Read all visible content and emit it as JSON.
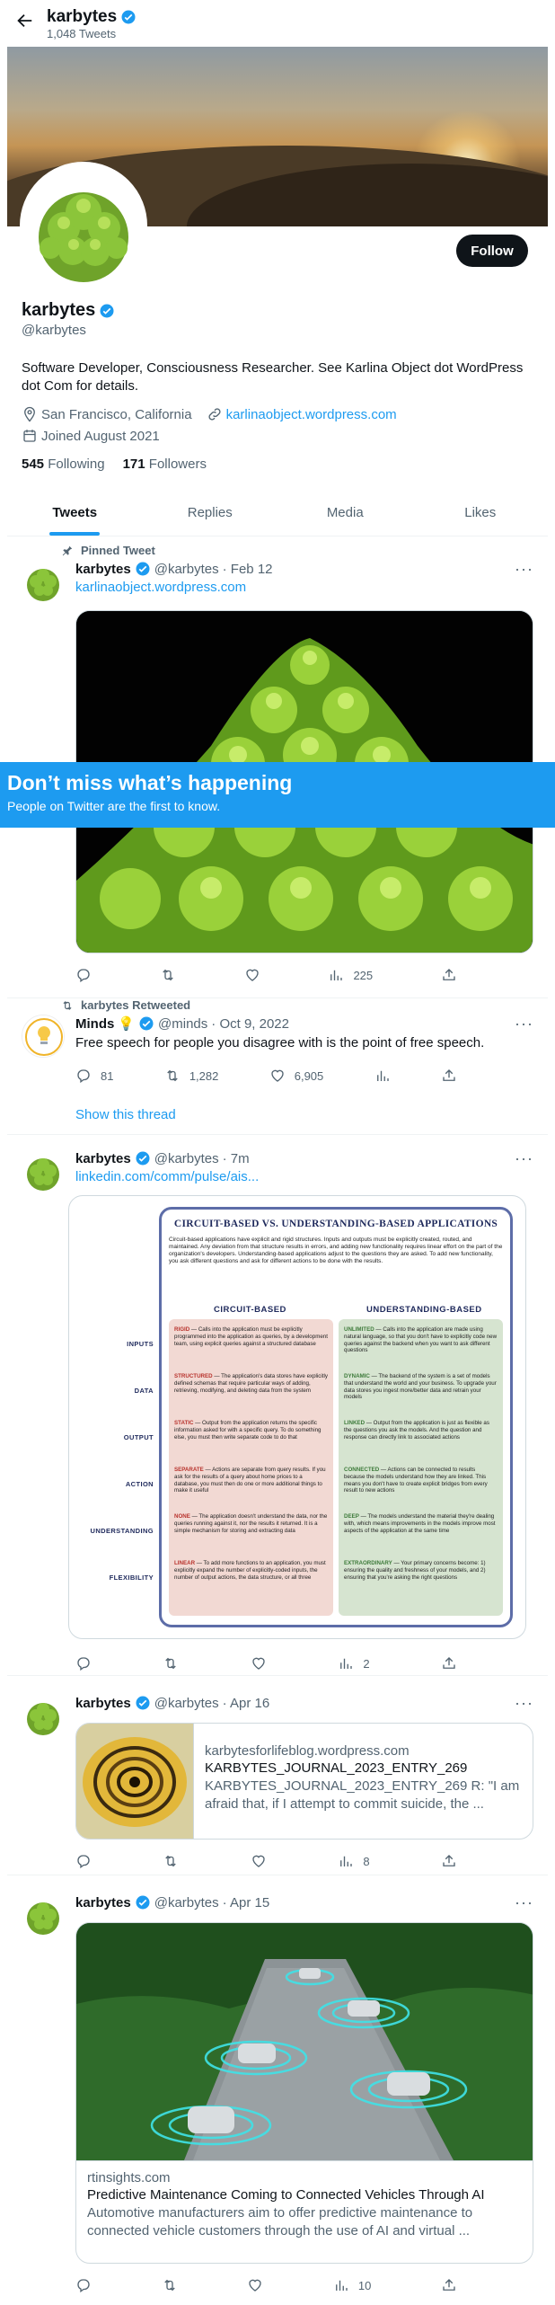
{
  "header": {
    "name": "karbytes",
    "tweet_count": "1,048 Tweets"
  },
  "profile": {
    "name": "karbytes",
    "handle": "@karbytes",
    "bio": "Software Developer, Consciousness Researcher. See Karlina Object dot WordPress dot Com for details.",
    "location": "San Francisco, California",
    "website": "karlinaobject.wordpress.com",
    "joined": "Joined August 2021",
    "following_count": "545",
    "following_label": "Following",
    "followers_count": "171",
    "followers_label": "Followers",
    "follow_button": "Follow"
  },
  "tabs": [
    {
      "label": "Tweets"
    },
    {
      "label": "Replies"
    },
    {
      "label": "Media"
    },
    {
      "label": "Likes"
    }
  ],
  "signup_banner": {
    "title": "Don’t miss what’s happening",
    "subtitle": "People on Twitter are the first to know."
  },
  "tweets": [
    {
      "social": "Pinned Tweet",
      "name": "karbytes",
      "handle": "@karbytes",
      "date": "· Feb 12",
      "link": "karlinaobject.wordpress.com",
      "views": "225"
    },
    {
      "social": "karbytes Retweeted",
      "name": "Minds",
      "handle": "@minds",
      "date": "· Oct 9, 2022",
      "text": "Free speech for people you disagree with is the point of free speech.",
      "replies": "81",
      "retweets": "1,282",
      "likes": "6,905",
      "show_thread": "Show this thread"
    },
    {
      "name": "karbytes",
      "handle": "@karbytes",
      "date": "· 7m",
      "link": "linkedin.com/comm/pulse/ais...",
      "views": "2"
    },
    {
      "name": "karbytes",
      "handle": "@karbytes",
      "date": "· Apr 16",
      "card_domain": "karbytesforlifeblog.wordpress.com",
      "card_title": "KARBYTES_JOURNAL_2023_ENTRY_269",
      "card_desc": "KARBYTES_JOURNAL_2023_ENTRY_269 R: \"I am afraid that, if I attempt to commit suicide, the ...",
      "views": "8"
    },
    {
      "name": "karbytes",
      "handle": "@karbytes",
      "date": "· Apr 15",
      "card_domain": "rtinsights.com",
      "card_title": "Predictive Maintenance Coming to Connected Vehicles Through AI",
      "card_desc": "Automotive manufacturers aim to offer predictive maintenance to connected vehicle customers through the use of AI and virtual ...",
      "views": "10"
    }
  ],
  "infographic": {
    "title": "CIRCUIT-BASED VS. UNDERSTANDING-BASED APPLICATIONS",
    "intro": "Circuit-based applications have explicit and rigid structures. Inputs and outputs must be explicitly created, routed, and maintained. Any deviation from that structure results in errors, and adding new functionality requires linear effort on the part of the organization's developers. Understanding-based applications adjust to the questions they are asked. To add new functionality, you ask different questions and ask for different actions to be done with the results.",
    "col_left": "CIRCUIT-BASED",
    "col_right": "UNDERSTANDING-BASED",
    "rows": [
      {
        "label": "INPUTS",
        "left_key": "RIGID",
        "left": " — Calls into the application must be explicitly programmed into the application as queries, by a development team, using explicit queries against a structured database",
        "right_key": "UNLIMITED",
        "right": " — Calls into the application are made using natural language, so that you don't have to explicitly code new queries against the backend when you want to ask different questions"
      },
      {
        "label": "DATA",
        "left_key": "STRUCTURED",
        "left": " — The application's data stores have explicitly defined schemas that require particular ways of adding, retrieving, modifying, and deleting data from the system",
        "right_key": "DYNAMIC",
        "right": " — The backend of the system is a set of models that understand the world and your business. To upgrade your data stores you ingest more/better data and retrain your models"
      },
      {
        "label": "OUTPUT",
        "left_key": "STATIC",
        "left": " — Output from the application returns the specific information asked for with a specific query. To do something else, you must then write separate code to do that",
        "right_key": "LINKED",
        "right": " — Output from the application is just as flexible as the questions you ask the models. And the question and response can directly link to associated actions"
      },
      {
        "label": "ACTION",
        "left_key": "SEPARATE",
        "left": " — Actions are separate from query results. If you ask for the results of a query about home prices to a database, you must then do one or more additional things to make it useful",
        "right_key": "CONNECTED",
        "right": " — Actions can be connected to results because the models understand how they are linked. This means you don't have to create explicit bridges from every result to new actions"
      },
      {
        "label": "UNDERSTANDING",
        "left_key": "NONE",
        "left": " — The application doesn't understand the data, nor the queries running against it, nor the results it returned. It is a simple mechanism for storing and extracting data",
        "right_key": "DEEP",
        "right": " — The models understand the material they're dealing with, which means improvements in the models improve most aspects of the application at the same time"
      },
      {
        "label": "FLEXIBILITY",
        "left_key": "LINEAR",
        "left": " — To add more functions to an application, you must explicitly expand the number of explicitly-coded inputs, the number of output actions, the data structure, or all three",
        "right_key": "EXTRAORDINARY",
        "right": " — Your primary concerns become: 1) ensuring the quality and freshness of your models, and 2) ensuring that you're asking the right questions"
      }
    ]
  },
  "colors": {
    "accent": "#1d9bf0",
    "text": "#0f1419",
    "muted": "#536471"
  }
}
